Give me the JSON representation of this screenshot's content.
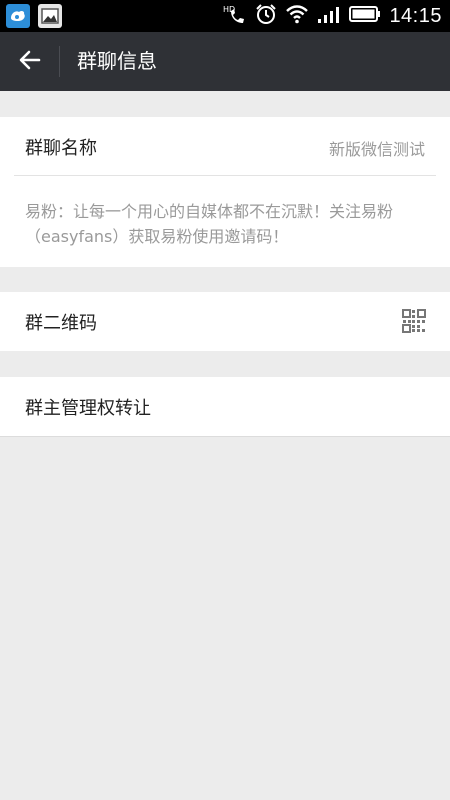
{
  "status_bar": {
    "time": "14:15",
    "icons": [
      "weibo-app-icon",
      "gallery-icon",
      "hd-call-icon",
      "alarm-icon",
      "wifi-icon",
      "signal-icon",
      "battery-icon"
    ]
  },
  "title_bar": {
    "back_icon": "arrow-left-icon",
    "title": "群聊信息"
  },
  "group_name": {
    "label": "群聊名称",
    "value": "新版微信测试"
  },
  "announcement": {
    "text": "易粉：让每一个用心的自媒体都不在沉默！关注易粉（easyfans）获取易粉使用邀请码！"
  },
  "qr_code": {
    "label": "群二维码",
    "icon": "qr-code-icon"
  },
  "transfer_owner": {
    "label": "群主管理权转让"
  },
  "colors": {
    "status_bar": "#000000",
    "title_bar": "#2f3136",
    "background": "#ececec",
    "card": "#ffffff",
    "secondary_text": "#9a9a9a"
  }
}
